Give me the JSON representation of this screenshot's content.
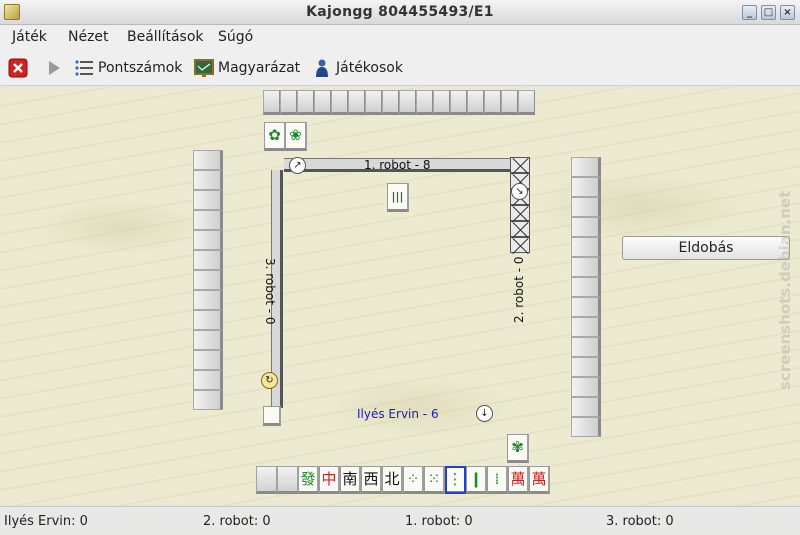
{
  "window": {
    "title": "Kajongg 804455493/E1"
  },
  "menu": [
    {
      "label": "Játék",
      "key": "J"
    },
    {
      "label": "Nézet",
      "key": "N"
    },
    {
      "label": "Beállítások",
      "key": "B"
    },
    {
      "label": "Súgó",
      "key": "S"
    }
  ],
  "toolbar": {
    "scores": "Pontszámok",
    "explain": "Magyarázat",
    "players": "Játékosok"
  },
  "board": {
    "north_label": "1. robot - 8",
    "east_label": "2. robot - 0",
    "west_label": "3. robot - 0",
    "self_label": "Ilyés Ervin - 6",
    "discard_button": "Eldobás"
  },
  "hand_tiles": [
    "發",
    "中",
    "南",
    "西",
    "北",
    "⁘",
    "⁙",
    "⋮",
    "❙",
    "⁞",
    "萬",
    "萬"
  ],
  "status": {
    "p1": "Ilyés Ervin: 0",
    "p2": "2. robot: 0",
    "p3": "1. robot: 0",
    "p4": "3. robot: 0"
  },
  "watermark": "screenshots.debian.net"
}
